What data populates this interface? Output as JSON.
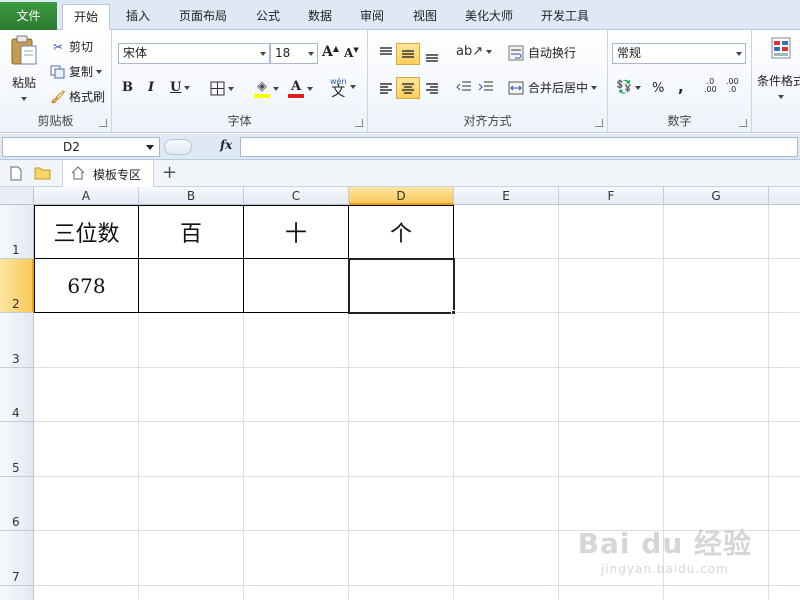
{
  "tabs": [
    "文件",
    "开始",
    "插入",
    "页面布局",
    "公式",
    "数据",
    "审阅",
    "视图",
    "美化大师",
    "开发工具"
  ],
  "ribbon": {
    "clipboard": {
      "paste": "粘贴",
      "cut": "剪切",
      "copy": "复制",
      "format_painter": "格式刷",
      "label": "剪贴板"
    },
    "font": {
      "name": "宋体",
      "size": "18",
      "bold": "B",
      "italic": "I",
      "underline": "U",
      "font_color_letter": "A",
      "phonetic": "文",
      "phonetic_top": "wén",
      "grow": "A",
      "shrink": "A",
      "label": "字体"
    },
    "alignment": {
      "wrap_text": "自动换行",
      "merge_center": "合并后居中",
      "label": "对齐方式"
    },
    "number": {
      "format": "常规",
      "percent": "%",
      "comma": ",",
      "inc_dec_a": ".0",
      "inc_dec_b": ".00",
      "label": "数字"
    },
    "styles": {
      "conditional": "条件格式"
    }
  },
  "formula_bar": {
    "name_box": "D2",
    "fx": "fx",
    "value": ""
  },
  "doc_tabs": {
    "template_zone": "模板专区",
    "add": "+"
  },
  "grid": {
    "columns": [
      "A",
      "B",
      "C",
      "D",
      "E",
      "F",
      "G"
    ],
    "rows": [
      "1",
      "2",
      "3",
      "4",
      "5",
      "6",
      "7"
    ],
    "selected_cell": "D2",
    "cells": {
      "A1": "三位数",
      "B1": "百",
      "C1": "十",
      "D1": "个",
      "A2": "678",
      "B2": "",
      "C2": "",
      "D2": ""
    }
  },
  "watermark": {
    "brand": "Bai du 经验",
    "url": "jingyan.baidu.com"
  },
  "colors": {
    "file_tab": "#2c7a30",
    "selection_header": "#f9c95b",
    "highlight_button": "#ffcf5a"
  }
}
